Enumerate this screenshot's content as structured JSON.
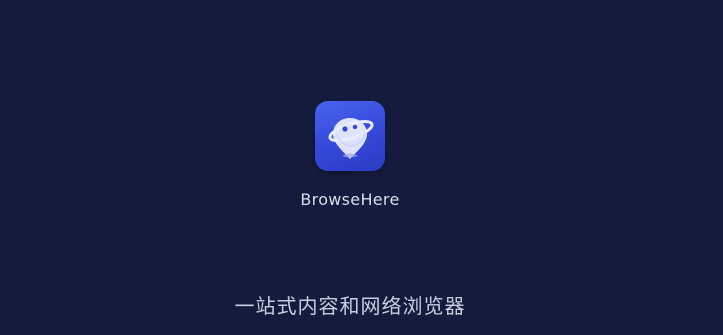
{
  "splash": {
    "app_name": "BrowseHere",
    "tagline": "一站式内容和网络浏览器",
    "icon": "planet-location-icon"
  },
  "colors": {
    "background": "#141b3d",
    "icon_gradient_start": "#4a63ef",
    "icon_gradient_end": "#2b3cc4",
    "text": "#d9ddea"
  }
}
